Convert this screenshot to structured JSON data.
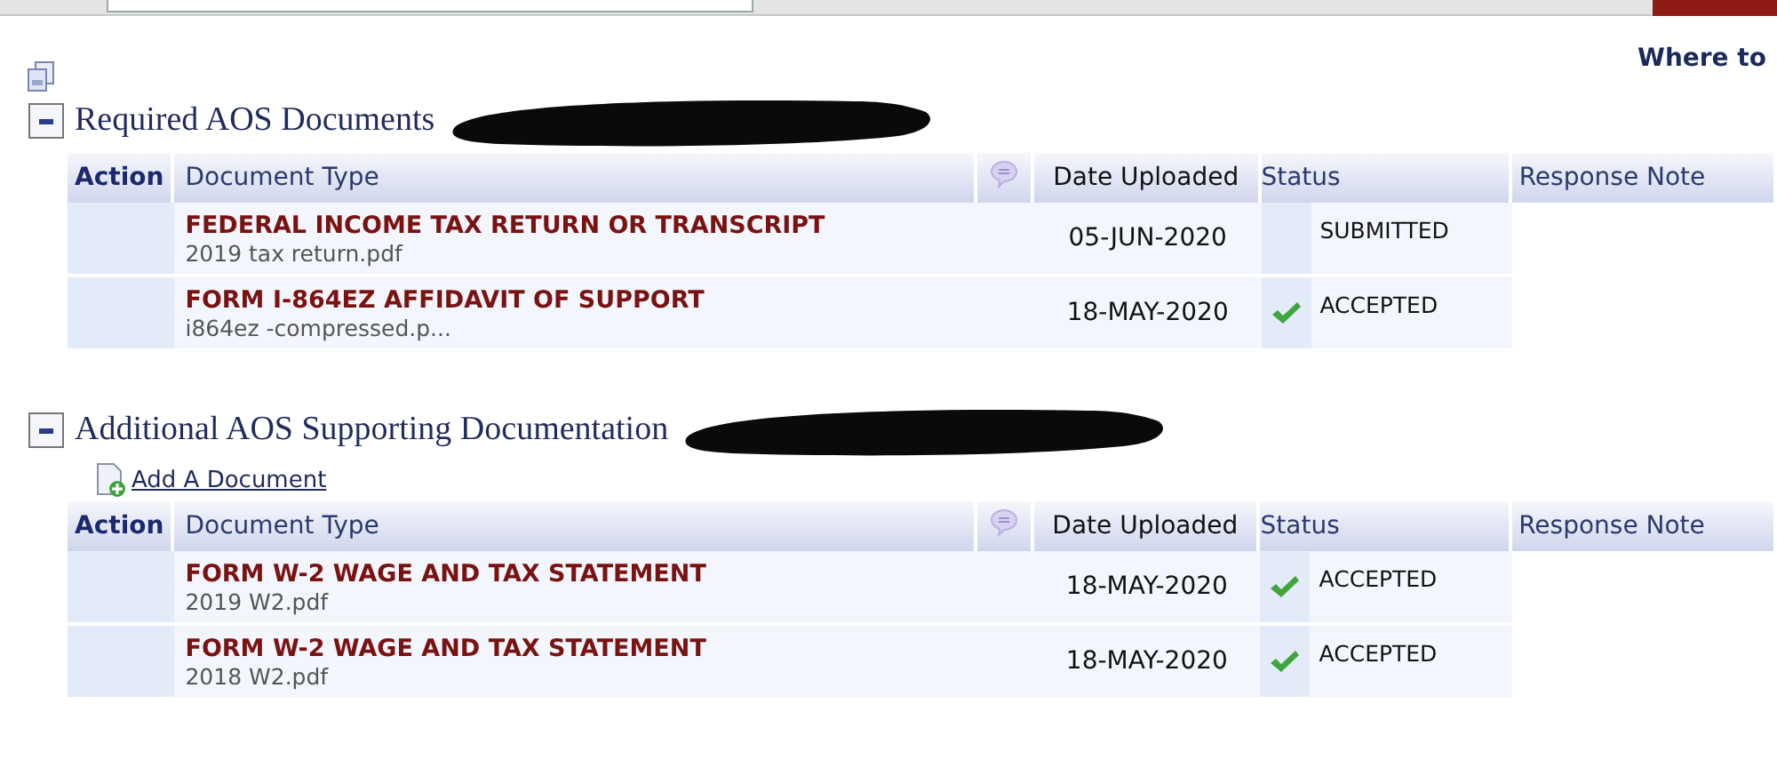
{
  "top_link": "Where to",
  "sections": [
    {
      "title": "Required AOS Documents",
      "redacted": true,
      "columns": [
        "Action",
        "Document Type",
        "Date Uploaded",
        "Status",
        "Response Note"
      ],
      "rows": [
        {
          "document_type": "FEDERAL INCOME TAX RETURN OR TRANSCRIPT",
          "file": "2019 tax return.pdf",
          "date": "05-JUN-2020",
          "status": "SUBMITTED",
          "accepted": false
        },
        {
          "document_type": "FORM I-864EZ AFFIDAVIT OF SUPPORT",
          "file": "i864ez -compressed.p...",
          "date": "18-MAY-2020",
          "status": "ACCEPTED",
          "accepted": true
        }
      ]
    },
    {
      "title": "Additional AOS Supporting Documentation",
      "redacted": true,
      "add_link": "Add A Document",
      "columns": [
        "Action",
        "Document Type",
        "Date Uploaded",
        "Status",
        "Response Note"
      ],
      "rows": [
        {
          "document_type": "FORM W-2 WAGE AND TAX STATEMENT",
          "file": "2019 W2.pdf",
          "date": "18-MAY-2020",
          "status": "ACCEPTED",
          "accepted": true
        },
        {
          "document_type": "FORM W-2 WAGE AND TAX STATEMENT",
          "file": "2018 W2.pdf",
          "date": "18-MAY-2020",
          "status": "ACCEPTED",
          "accepted": true
        }
      ]
    }
  ]
}
